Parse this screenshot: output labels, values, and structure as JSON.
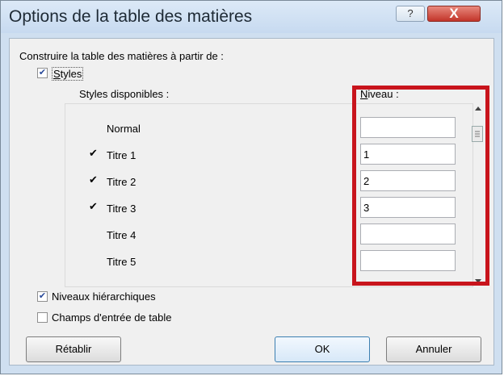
{
  "window": {
    "title": "Options de la table des matières",
    "help_glyph": "?",
    "close_glyph": "X"
  },
  "build_from_label": "Construire la table des matières à partir de :",
  "styles_checkbox": {
    "label": "Styles",
    "checked": true
  },
  "available_styles_label": "Styles disponibles :",
  "level_label": "Niveau :",
  "styles": [
    {
      "name": "Normal",
      "checked": false,
      "level": ""
    },
    {
      "name": "Titre 1",
      "checked": true,
      "level": "1"
    },
    {
      "name": "Titre 2",
      "checked": true,
      "level": "2"
    },
    {
      "name": "Titre 3",
      "checked": true,
      "level": "3"
    },
    {
      "name": "Titre 4",
      "checked": false,
      "level": ""
    },
    {
      "name": "Titre 5",
      "checked": false,
      "level": ""
    }
  ],
  "check_glyph": "✔",
  "outline_levels": {
    "label": "Niveaux hiérarchiques",
    "checked": true
  },
  "table_entry_fields": {
    "label": "Champs d'entrée de table",
    "checked": false
  },
  "buttons": {
    "reset": "Rétablir",
    "ok": "OK",
    "cancel": "Annuler"
  },
  "highlight_color": "#c8141c"
}
